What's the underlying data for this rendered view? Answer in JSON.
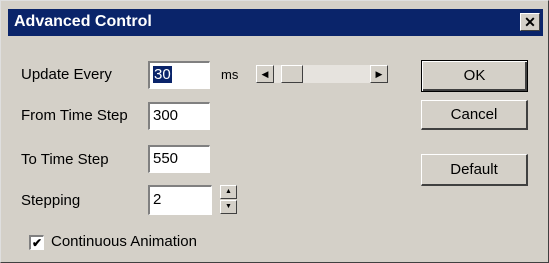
{
  "window": {
    "title": "Advanced Control",
    "close_glyph": "✕"
  },
  "fields": {
    "update_every": {
      "label": "Update Every",
      "value": "30",
      "unit": "ms"
    },
    "from_time_step": {
      "label": "From Time Step",
      "value": "300"
    },
    "to_time_step": {
      "label": "To Time Step",
      "value": "550"
    },
    "stepping": {
      "label": "Stepping",
      "value": "2"
    }
  },
  "slider": {
    "left_arrow": "◀",
    "right_arrow": "▶",
    "position_fraction": 0.1
  },
  "spinner": {
    "up": "▲",
    "down": "▼"
  },
  "checkbox": {
    "label": "Continuous Animation",
    "checked": true,
    "check_glyph": "✔"
  },
  "buttons": {
    "ok": "OK",
    "cancel": "Cancel",
    "default": "Default"
  }
}
